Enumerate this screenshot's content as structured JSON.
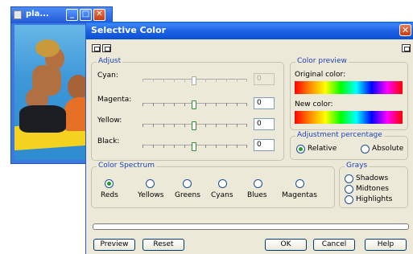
{
  "background_window": {
    "title": "pla...",
    "minimize": "_",
    "maximize": "□",
    "close": "✕"
  },
  "dialog": {
    "title": "Selective Color",
    "close": "✕",
    "adjust": {
      "legend": "Adjust",
      "rows": [
        {
          "label": "Cyan:",
          "value": "0",
          "enabled": false
        },
        {
          "label": "Magenta:",
          "value": "0",
          "enabled": true
        },
        {
          "label": "Yellow:",
          "value": "0",
          "enabled": true
        },
        {
          "label": "Black:",
          "value": "0",
          "enabled": true
        }
      ]
    },
    "color_preview": {
      "legend": "Color preview",
      "original_label": "Original color:",
      "new_label": "New color:"
    },
    "adjustment_percentage": {
      "legend": "Adjustment percentage",
      "options": [
        "Relative",
        "Absolute"
      ],
      "selected": "Relative"
    },
    "color_spectrum": {
      "legend": "Color Spectrum",
      "options": [
        "Reds",
        "Yellows",
        "Greens",
        "Cyans",
        "Blues",
        "Magentas"
      ],
      "selected": "Reds"
    },
    "grays": {
      "legend": "Grays",
      "options": [
        "Shadows",
        "Midtones",
        "Highlights"
      ]
    },
    "progress_value": 0,
    "buttons": {
      "preview": "Preview",
      "reset": "Reset",
      "ok": "OK",
      "cancel": "Cancel",
      "help": "Help"
    },
    "icons": [
      "compare-view-icon",
      "compare-view-icon",
      "flyout-menu-icon"
    ]
  }
}
